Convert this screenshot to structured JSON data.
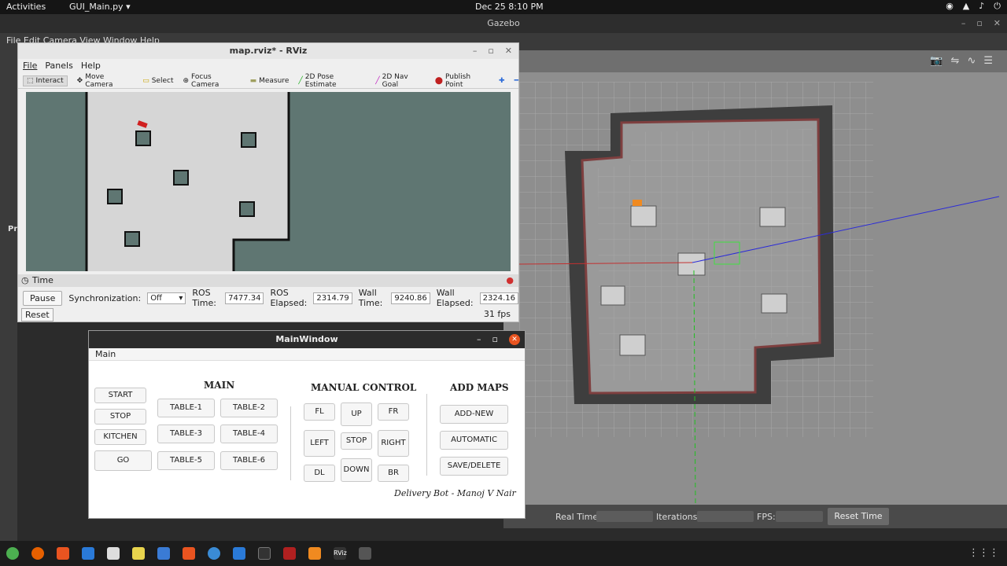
{
  "topbar": {
    "activities": "Activities",
    "app": "GUI_Main.py ▾",
    "clock": "Dec 25  8:10 PM",
    "tray": [
      "◉",
      "▲",
      "♪",
      "⏻"
    ]
  },
  "gazebo": {
    "title": "Gazebo",
    "menu": "File   Edit   Camera   View   Window   Help",
    "side_label": "Pr",
    "tools": [
      "📷",
      "⇋",
      "∿",
      "☰"
    ],
    "bottom": {
      "real_time": "Real Time:",
      "iterations": "Iterations:",
      "fps": "FPS:",
      "reset": "Reset Time"
    }
  },
  "rviz": {
    "title": "map.rviz* - RViz",
    "menu": [
      "File",
      "Panels",
      "Help"
    ],
    "tools": [
      {
        "label": "Interact",
        "icon": "⬚"
      },
      {
        "label": "Move Camera",
        "icon": "✥"
      },
      {
        "label": "Select",
        "icon": "▭"
      },
      {
        "label": "Focus Camera",
        "icon": "⊕"
      },
      {
        "label": "Measure",
        "icon": "▬"
      },
      {
        "label": "2D Pose Estimate",
        "icon": "╱"
      },
      {
        "label": "2D Nav Goal",
        "icon": "╱"
      },
      {
        "label": "Publish Point",
        "icon": "⬤"
      }
    ],
    "time_panel": "Time",
    "pause": "Pause",
    "sync_label": "Synchronization:",
    "sync_value": "Off",
    "ros_time_label": "ROS Time:",
    "ros_time": "7477.34",
    "ros_elapsed_label": "ROS Elapsed:",
    "ros_elapsed": "2314.79",
    "wall_time_label": "Wall Time:",
    "wall_time": "9240.86",
    "wall_elapsed_label": "Wall Elapsed:",
    "wall_elapsed": "2324.16",
    "reset": "Reset",
    "fps": "31 fps"
  },
  "main_window": {
    "title": "MainWindow",
    "menu": "Main",
    "main_heading": "MAIN",
    "manual_heading": "MANUAL CONTROL",
    "maps_heading": "ADD MAPS",
    "left_buttons": [
      "START",
      "STOP",
      "KITCHEN",
      "GO"
    ],
    "tables": [
      "TABLE-1",
      "TABLE-2",
      "TABLE-3",
      "TABLE-4",
      "TABLE-5",
      "TABLE-6"
    ],
    "manual": {
      "fl": "FL",
      "up": "UP",
      "fr": "FR",
      "left": "LEFT",
      "stop": "STOP",
      "right": "RIGHT",
      "dl": "DL",
      "down": "DOWN",
      "br": "BR"
    },
    "maps": [
      "ADD-NEW",
      "AUTOMATIC",
      "SAVE/DELETE"
    ],
    "signature": "Delivery Bot - Manoj V Nair"
  }
}
